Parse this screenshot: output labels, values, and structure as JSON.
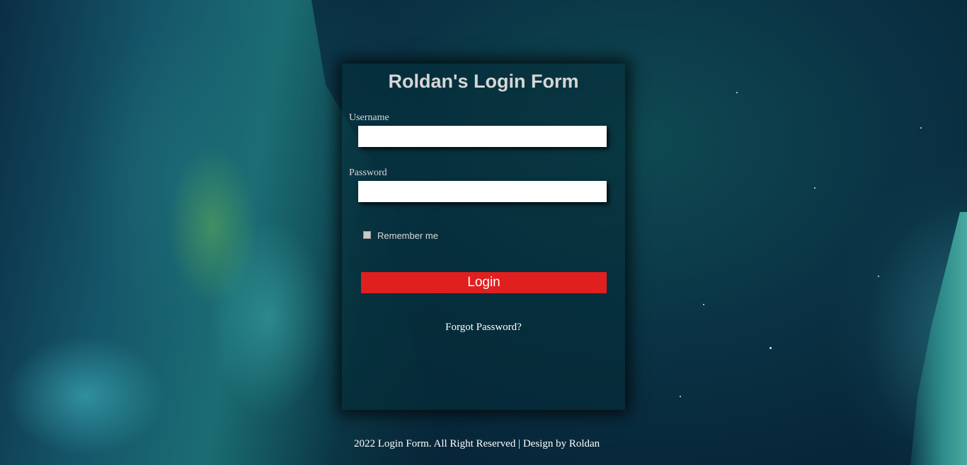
{
  "form": {
    "title": "Roldan's Login Form",
    "username_label": "Username",
    "username_value": "",
    "password_label": "Password",
    "password_value": "",
    "remember_label": "Remember me",
    "remember_checked": false,
    "login_label": "Login",
    "forgot_label": "Forgot Password?"
  },
  "footer": {
    "text": "2022 Login Form. All Right Reserved | Design by Roldan"
  },
  "colors": {
    "login_button": "#e01f1f",
    "card_background": "rgba(4, 42, 52, 0.55)",
    "text_light": "#d9d9d9"
  }
}
